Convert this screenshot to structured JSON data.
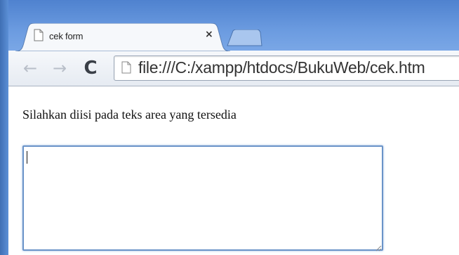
{
  "browser": {
    "tab": {
      "title": "cek form",
      "close_glyph": "×",
      "icon": "page-icon"
    },
    "new_tab_icon": "new-tab-icon",
    "toolbar": {
      "back_glyph": "←",
      "forward_glyph": "→",
      "reload_glyph": "C",
      "address": "file:///C:/xampp/htdocs/BukuWeb/cek.htm",
      "address_icon": "page-icon"
    },
    "frame_color": "#4f82cf"
  },
  "page": {
    "prompt": "Silahkan diisi pada teks area yang tersedia",
    "textarea": {
      "value": "",
      "focused": true
    }
  }
}
